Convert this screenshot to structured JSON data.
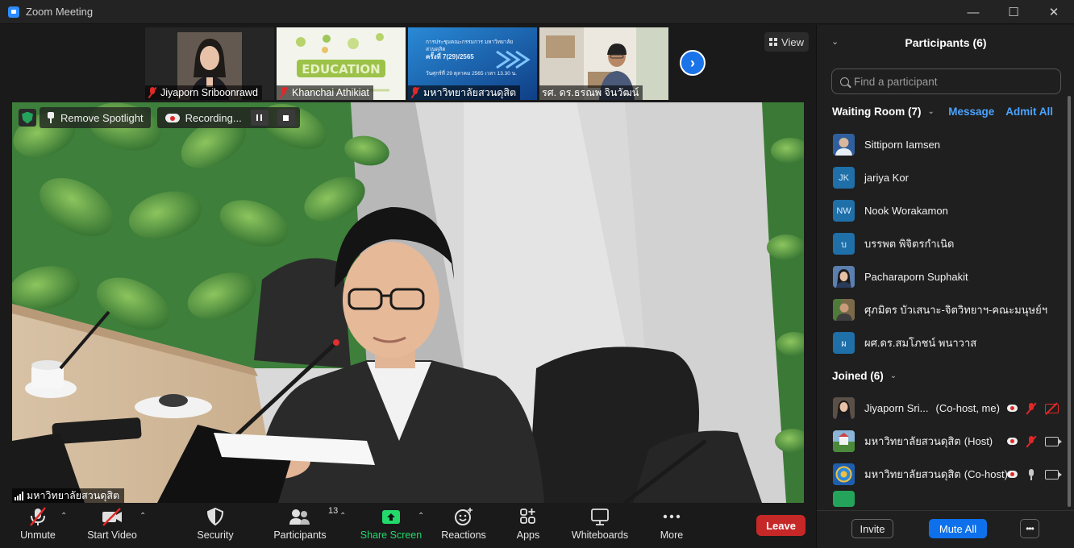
{
  "window": {
    "title": "Zoom Meeting"
  },
  "thumbnails": [
    {
      "name": "Jiyaporn Sriboonrawd"
    },
    {
      "name": "Khanchai Athikiat"
    },
    {
      "name": "มหาวิทยาลัยสวนดุสิต"
    },
    {
      "name": "รศ. ดร.ธรณพ จินวัฒน์"
    }
  ],
  "slide": {
    "line1": "การประชุมคณะกรรมการ มหาวิทยาลัยสวนดุสิต",
    "line2": "ครั้งที่ 7(29)/2565",
    "line3": "วันศุกร์ที่ 29 ตุลาคม 2565 เวลา 13.30 น."
  },
  "view_button": {
    "label": "View"
  },
  "spotlight": {
    "remove_label": "Remove Spotlight",
    "recording_label": "Recording...",
    "speaker_name": "มหาวิทยาลัยสวนดุสิต"
  },
  "toolbar": {
    "unmute": "Unmute",
    "start_video": "Start Video",
    "security": "Security",
    "participants": "Participants",
    "participants_count": "13",
    "share_screen": "Share Screen",
    "reactions": "Reactions",
    "apps": "Apps",
    "whiteboards": "Whiteboards",
    "more": "More",
    "leave": "Leave"
  },
  "panel": {
    "title": "Participants (6)",
    "search_placeholder": "Find a participant",
    "waiting_room": {
      "label": "Waiting Room (7)",
      "message": "Message",
      "admit_all": "Admit All",
      "people": [
        {
          "name": "Sittiporn Iamsen",
          "initials": "",
          "color": "#3a6fb0"
        },
        {
          "name": "jariya Kor",
          "initials": "JK",
          "color": "#1f6fa8"
        },
        {
          "name": "Nook Worakamon",
          "initials": "NW",
          "color": "#1f6fa8"
        },
        {
          "name": "บรรพต พิจิตรกำเนิด",
          "initials": "บ",
          "color": "#1f6fa8"
        },
        {
          "name": "Pacharaporn Suphakit",
          "initials": "",
          "color": "#4a6d9a"
        },
        {
          "name": "ศุภมิตร บัวเสนาะ-จิตวิทยาฯ-คณะมนุษย์ฯ",
          "initials": "",
          "color": "#6b5a3e"
        },
        {
          "name": "ผศ.ดร.สมโภชน์ พนาวาส",
          "initials": "ผ",
          "color": "#1f6fa8"
        }
      ]
    },
    "joined": {
      "label": "Joined (6)",
      "people": [
        {
          "name": "Jiyaporn Sri...",
          "role": "(Co-host, me)"
        },
        {
          "name": "มหาวิทยาลัยสวนดุสิต",
          "role": "(Host)"
        },
        {
          "name": "มหาวิทยาลัยสวนดุสิต",
          "role": "(Co-host)"
        }
      ]
    },
    "footer": {
      "invite": "Invite",
      "mute_all": "Mute All",
      "more": "•••"
    }
  }
}
